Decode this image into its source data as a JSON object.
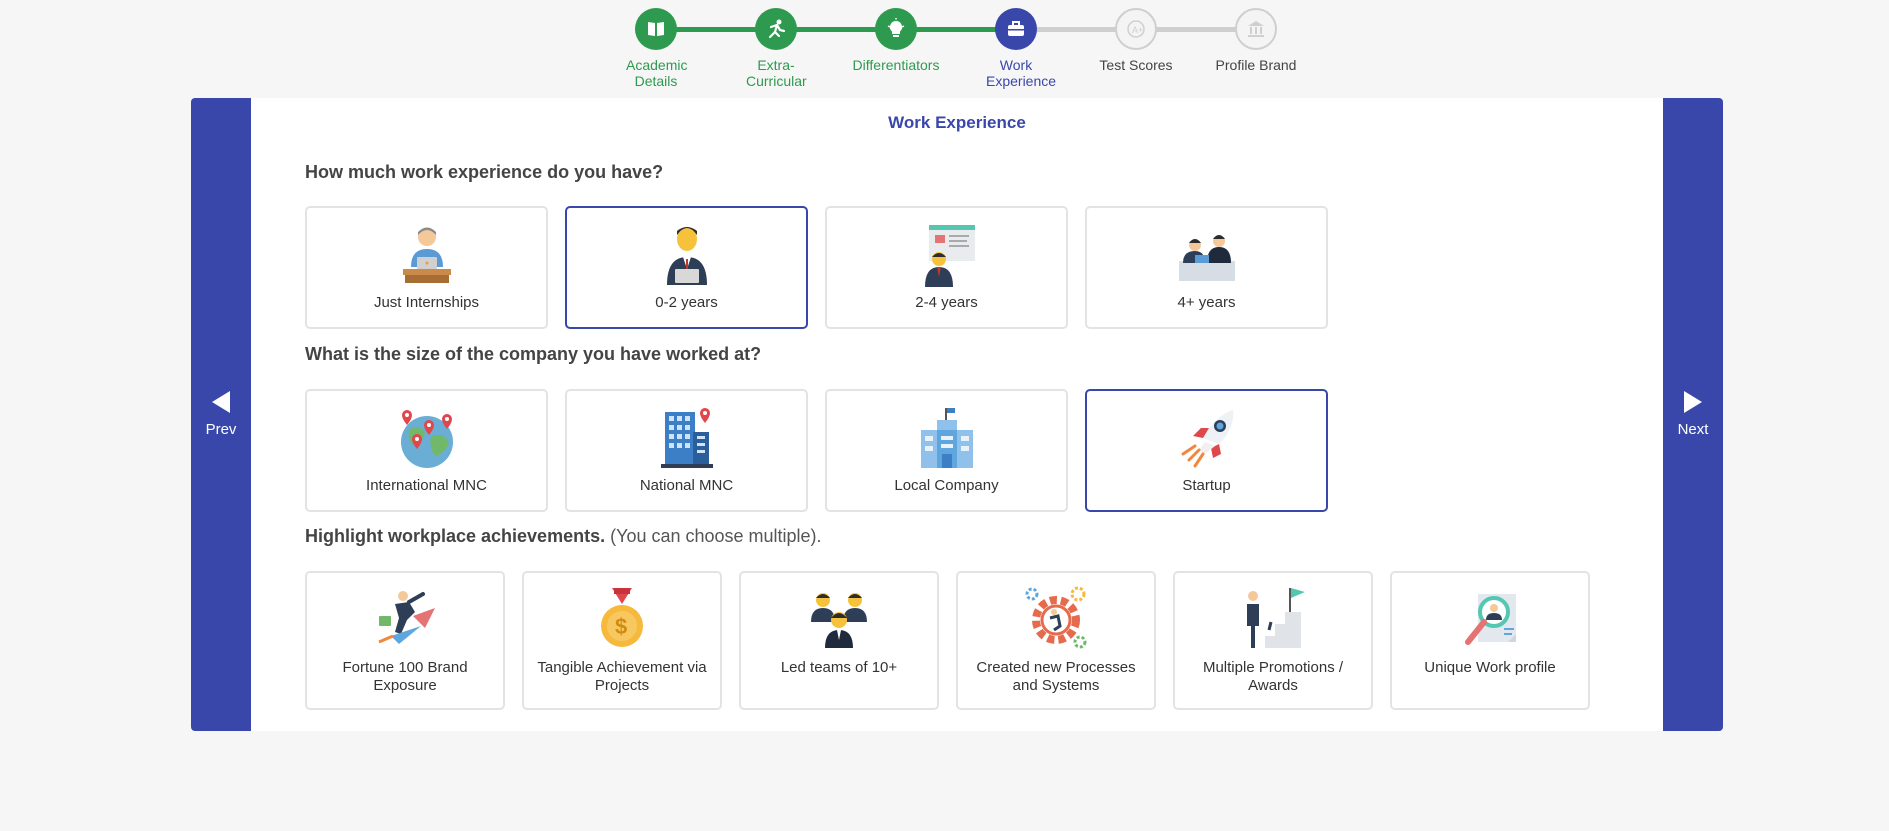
{
  "stepper": {
    "steps": [
      {
        "label": "Academic Details",
        "state": "done",
        "icon": "book-icon"
      },
      {
        "label": "Extra-Curricular",
        "state": "done",
        "icon": "runner-icon"
      },
      {
        "label": "Differentiators",
        "state": "done",
        "icon": "lightbulb-icon"
      },
      {
        "label": "Work Experience",
        "state": "active",
        "icon": "briefcase-icon"
      },
      {
        "label": "Test Scores",
        "state": "todo",
        "icon": "grade-icon"
      },
      {
        "label": "Profile Brand",
        "state": "todo",
        "icon": "bank-icon"
      }
    ]
  },
  "nav": {
    "prev_label": "Prev",
    "next_label": "Next"
  },
  "page": {
    "title": "Work Experience"
  },
  "q1": {
    "question": "How much work experience do you have?",
    "options": [
      {
        "label": "Just Internships",
        "selected": false,
        "icon": "intern-laptop-icon"
      },
      {
        "label": "0-2 years",
        "selected": true,
        "icon": "professional-laptop-icon"
      },
      {
        "label": "2-4 years",
        "selected": false,
        "icon": "presenter-board-icon"
      },
      {
        "label": "4+ years",
        "selected": false,
        "icon": "meeting-team-icon"
      }
    ]
  },
  "q2": {
    "question": "What is the size of the company you have worked at?",
    "options": [
      {
        "label": "International MNC",
        "selected": false,
        "icon": "globe-pins-icon"
      },
      {
        "label": "National MNC",
        "selected": false,
        "icon": "tall-building-icon"
      },
      {
        "label": "Local Company",
        "selected": false,
        "icon": "office-building-icon"
      },
      {
        "label": "Startup",
        "selected": true,
        "icon": "rocket-icon"
      }
    ]
  },
  "q3": {
    "question": "Highlight workplace achievements.",
    "note": " (You can choose multiple).",
    "options": [
      {
        "label": "Fortune 100 Brand Exposure",
        "icon": "businessman-rocket-icon"
      },
      {
        "label": "Tangible Achievement via Projects",
        "icon": "gold-medal-icon"
      },
      {
        "label": "Led teams of 10+",
        "icon": "team-icon"
      },
      {
        "label": "Created new Processes and Systems",
        "icon": "gears-icon"
      },
      {
        "label": "Multiple Promotions / Awards",
        "icon": "stairs-flag-icon"
      },
      {
        "label": "Unique Work profile",
        "icon": "profile-search-icon"
      }
    ]
  },
  "colors": {
    "primary": "#3a47aa",
    "done": "#2e9a4f",
    "todo": "#cfcfcf",
    "background": "#f6f6f6"
  }
}
